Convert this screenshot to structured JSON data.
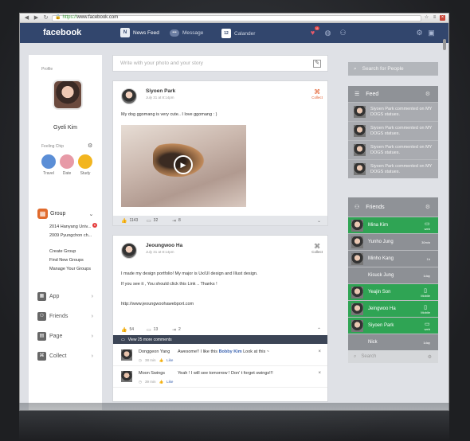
{
  "browser": {
    "url_https": "https://",
    "url_host": "www.facebook.com"
  },
  "topbar": {
    "logo": "facebook",
    "nav": [
      {
        "icon": "N",
        "label": "News Feed"
      },
      {
        "icon": "msg",
        "label": "Message"
      },
      {
        "icon": "12",
        "label": "Calander"
      }
    ],
    "notif_badge": "11"
  },
  "profile": {
    "section_label": "Profile",
    "name": "Gyeli Kim",
    "feeling_label": "Feeling Chip",
    "chips": [
      "Travel",
      "Date",
      "Study"
    ]
  },
  "group": {
    "title": "Group",
    "items": [
      "2014 Hanyang Univ...",
      "2009 Pyungchon ch..."
    ],
    "badge": "6",
    "links": [
      "Create Group",
      "Find New Groups",
      "Manage Your Groups"
    ]
  },
  "menu": [
    "App",
    "Friends",
    "Page",
    "Collect"
  ],
  "compose": {
    "placeholder": "Write with your photo and your story"
  },
  "posts": [
    {
      "name": "Siyoen Park",
      "time": "July 31 at 8:14pm",
      "badge": "Collect",
      "text": "My dog ggomang is very cute.. I love ggomang : )",
      "likes": "1143",
      "comments": "32",
      "shares": "8"
    },
    {
      "name": "Jeoungwoo Ha",
      "time": "July 31 at 8:14pm",
      "badge": "Collect",
      "text1": "I made my design portfolio!  My major is Ux/UI design and Illust design.",
      "text2": "If you see it , You should click this Link .. Thanks !",
      "link": "http://www.jeoungwoohawebport.com",
      "likes": "54",
      "comments": "13",
      "shares": "2",
      "view_more": "View 25 more comments",
      "comment_list": [
        {
          "name": "Donggeon Yang",
          "text": "Awesome!! I like this",
          "tag": "Bobby Kim",
          "tail": "Look at this ~",
          "time": "38 min",
          "like": "Like"
        },
        {
          "name": "Moon Swings",
          "text": "Yeah ! I will see tomorrow ! Don' t forget swings!!!",
          "time": "39 min",
          "like": "Like"
        }
      ]
    }
  ],
  "right": {
    "search_placeholder": "Search for People",
    "feed_title": "Feed",
    "feed_items": [
      "Siyoen Park commented on MY DOGS statues.",
      "Siyoen Park commented on MY DOGS statues.",
      "Siyoen Park commented on MY DOGS statues.",
      "Siyoen Park commented on MY DOGS statues."
    ],
    "friends_title": "Friends",
    "friends": [
      {
        "name": "Mina Kim",
        "status": "web",
        "online": true
      },
      {
        "name": "Yunho Jung",
        "status": "30min",
        "online": false
      },
      {
        "name": "Minho Kang",
        "status": "1h",
        "online": false
      },
      {
        "name": "Kisuck Jung",
        "status": "1day",
        "online": false
      },
      {
        "name": "Yeajin Son",
        "status": "Mobile",
        "online": true
      },
      {
        "name": "Jeingwoo Ha",
        "status": "Mobile",
        "online": true
      },
      {
        "name": "Siyoen Park",
        "status": "web",
        "online": true
      },
      {
        "name": "Nick",
        "status": "1day",
        "online": false
      }
    ],
    "friend_search": "Search"
  }
}
